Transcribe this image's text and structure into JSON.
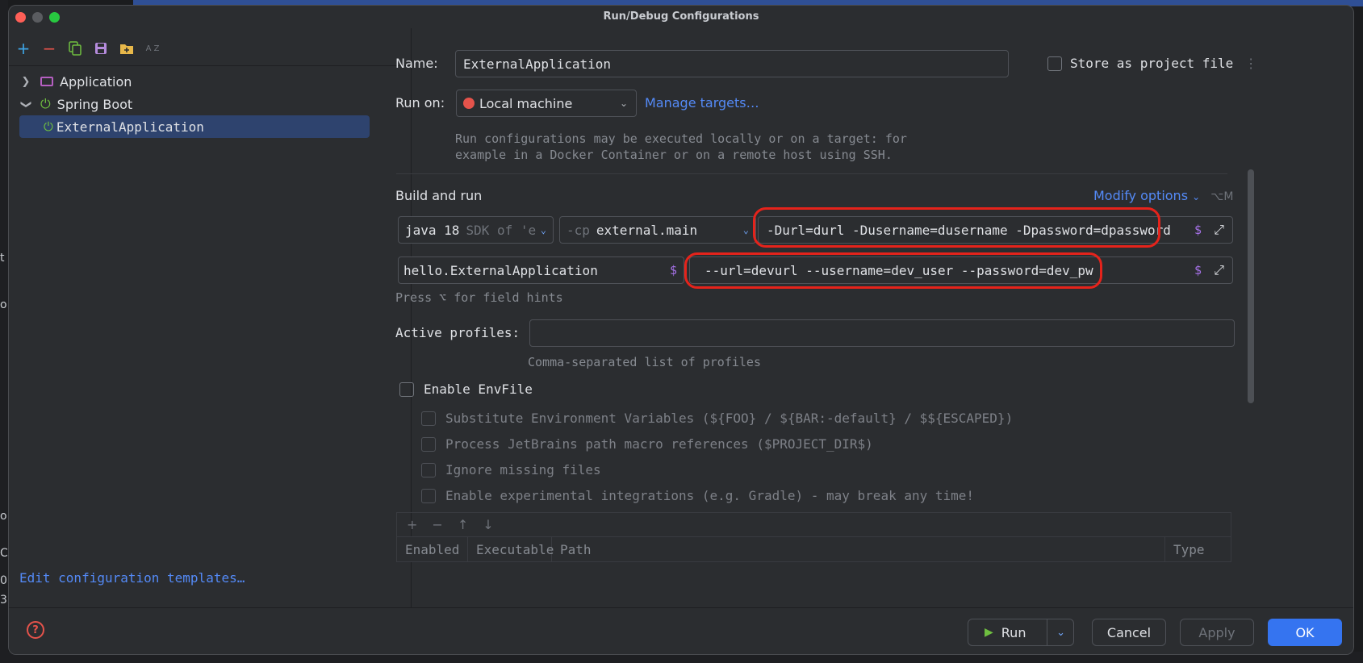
{
  "window": {
    "title": "Run/Debug Configurations"
  },
  "background_glyphs": [
    "t",
    "o",
    "o",
    "Co",
    "0",
    "3"
  ],
  "sidebar": {
    "toolbar_icons": [
      "add-icon",
      "remove-icon",
      "copy-icon",
      "save-icon",
      "folder-add-icon",
      "sort-az-icon"
    ],
    "sort_label": "A Z",
    "tree": [
      {
        "label": "Application",
        "icon": "application-icon",
        "expanded": false
      },
      {
        "label": "Spring Boot",
        "icon": "spring-boot-icon",
        "expanded": true
      },
      {
        "label": "ExternalApplication",
        "icon": "spring-power-icon",
        "selected": true
      }
    ],
    "edit_templates_link": "Edit configuration templates…"
  },
  "config": {
    "name_label": "Name:",
    "name_value": "ExternalApplication",
    "store_as_project_file": "Store as project file",
    "run_on_label": "Run on:",
    "run_on_value": "Local machine",
    "manage_targets": "Manage targets…",
    "run_on_hint_line1": "Run configurations may be executed locally or on a target: for",
    "run_on_hint_line2": "example in a Docker Container or on a remote host using SSH.",
    "build_and_run_label": "Build and run",
    "modify_options": "Modify options",
    "modify_options_shortcut": "⌥M",
    "jdk_main": "java 18",
    "jdk_dim": "SDK of 'e",
    "cp_prefix": "-cp",
    "cp_value": "external.main",
    "vm_options": "-Durl=durl -Dusername=dusername -Dpassword=dpassword",
    "main_class": "hello.ExternalApplication",
    "program_args": "--url=devurl --username=dev_user --password=dev_pw",
    "field_hints": "Press ⌥ for field hints",
    "active_profiles_label": "Active profiles:",
    "active_profiles_value": "",
    "profiles_hint": "Comma-separated list of profiles",
    "enable_envfile": "Enable EnvFile",
    "env_options": [
      "Substitute Environment Variables (${FOO} / ${BAR:-default} / $${ESCAPED})",
      "Process JetBrains path macro references ($PROJECT_DIR$)",
      "Ignore missing files",
      "Enable experimental integrations (e.g. Gradle) - may break any time!"
    ],
    "table_tools": [
      "+",
      "−",
      "↑",
      "↓"
    ],
    "table_columns": [
      "Enabled",
      "Executable",
      "Path",
      "Type"
    ]
  },
  "buttons": {
    "run": "Run",
    "cancel": "Cancel",
    "apply": "Apply",
    "ok": "OK",
    "help": "?"
  },
  "colors": {
    "accent_blue": "#3574f0",
    "link_blue": "#548af7",
    "selection": "#2e436e",
    "highlight_red": "#e5231b",
    "spring_green": "#6fbf40",
    "dollar_purple": "#a571e6"
  }
}
